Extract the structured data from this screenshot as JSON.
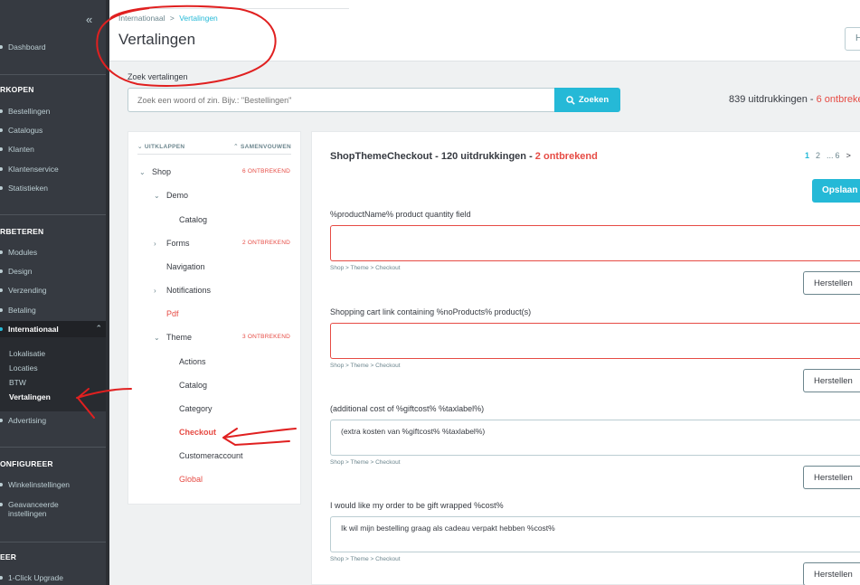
{
  "sidebar": {
    "dashboard": "Dashboard",
    "section_sell": "RKOPEN",
    "sell_items": [
      "Bestellingen",
      "Catalogus",
      "Klanten",
      "Klantenservice",
      "Statistieken"
    ],
    "section_improve": "RBETEREN",
    "improve_items": [
      "Modules",
      "Design",
      "Verzending",
      "Betaling"
    ],
    "international": "Internationaal",
    "international_sub": [
      "Lokalisatie",
      "Locaties",
      "BTW",
      "Vertalingen"
    ],
    "advertising": "Advertising",
    "section_configure": "ONFIGUREER",
    "configure_items": [
      "Winkelinstellingen",
      "Geavanceerde",
      "instellingen"
    ],
    "section_more": "EER",
    "more_items": [
      "1-Click Upgrade"
    ]
  },
  "header": {
    "breadcrumb_parent": "Internationaal",
    "breadcrumb_sep": ">",
    "breadcrumb_current": "Vertalingen",
    "title": "Vertalingen",
    "help_label": "H"
  },
  "search": {
    "label": "Zoek vertalingen",
    "placeholder": "Zoek een woord of zin. Bijv.: \"Bestellingen\"",
    "button": "Zoeken"
  },
  "summary": {
    "count": "839 uitdrukkingen",
    "sep": " - ",
    "missing": "6 ontbrekend"
  },
  "tree": {
    "expand": "UITKLAPPEN",
    "collapse": "SAMENVOUWEN",
    "nodes": {
      "shop": "Shop",
      "shop_missing": "6 ONTBREKEND",
      "demo": "Demo",
      "demo_catalog": "Catalog",
      "forms": "Forms",
      "forms_missing": "2 ONTBREKEND",
      "navigation": "Navigation",
      "notifications": "Notifications",
      "pdf": "Pdf",
      "theme": "Theme",
      "theme_missing": "3 ONTBREKEND",
      "actions": "Actions",
      "catalog": "Catalog",
      "category": "Category",
      "checkout": "Checkout",
      "customeraccount": "Customeraccount",
      "global": "Global"
    }
  },
  "translations": {
    "domain": "ShopThemeCheckout",
    "domain_count": "120 uitdrukkingen",
    "domain_sep": " - ",
    "domain_missing": "2 ontbrekend",
    "pages": [
      "1",
      "2",
      "...",
      "6"
    ],
    "next_icon": ">",
    "save_label": "Opslaan",
    "reset_label": "Herstellen",
    "items": [
      {
        "label": "%productName% product quantity field",
        "value": "",
        "path": "Shop > Theme > Checkout"
      },
      {
        "label": "Shopping cart link containing %noProducts% product(s)",
        "value": "",
        "path": "Shop > Theme > Checkout"
      },
      {
        "label": "(additional cost of %giftcost% %taxlabel%)",
        "value": "(extra kosten van %giftcost% %taxlabel%)",
        "path": "Shop > Theme > Checkout"
      },
      {
        "label": "I would like my order to be gift wrapped %cost%",
        "value": "Ik wil mijn bestelling graag als cadeau verpakt hebben %cost%",
        "path": "Shop > Theme > Checkout"
      }
    ]
  },
  "colors": {
    "accent": "#25b9d7",
    "missing": "#e64b44",
    "sidebar_bg": "#363a41",
    "annotation": "#e02020"
  }
}
